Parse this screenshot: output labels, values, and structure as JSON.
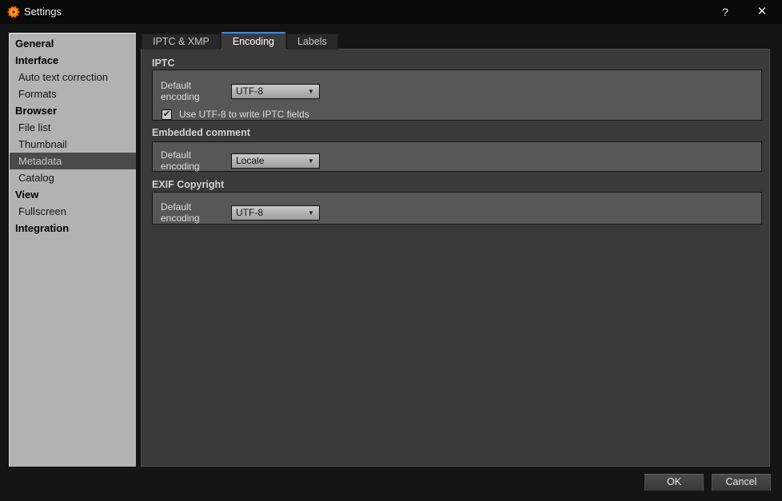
{
  "window": {
    "title": "Settings",
    "help_label": "?",
    "close_label": "✕"
  },
  "icons": {
    "dropdown_arrow": "▼",
    "checkbox_check": "✔"
  },
  "colors": {
    "accent_blue": "#2e8fff",
    "titlebar_bg": "#0a0a0a",
    "window_bg": "#141414",
    "sidebar_bg": "#b2b2b2",
    "sidebar_selected_bg": "#4a4a4a",
    "pane_bg": "#3a3a3a",
    "group_bg": "#575757",
    "app_icon_orange": "#ff8a00"
  },
  "sidebar": {
    "items": [
      {
        "label": "General"
      },
      {
        "label": "Interface"
      },
      {
        "label": "Auto text correction"
      },
      {
        "label": "Formats"
      },
      {
        "label": "Browser"
      },
      {
        "label": "File list"
      },
      {
        "label": "Thumbnail"
      },
      {
        "label": "Metadata",
        "selected": true
      },
      {
        "label": "Catalog"
      },
      {
        "label": "View"
      },
      {
        "label": "Fullscreen"
      },
      {
        "label": "Integration"
      }
    ]
  },
  "tabs": [
    {
      "label": "IPTC & XMP"
    },
    {
      "label": "Encoding",
      "active": true
    },
    {
      "label": "Labels"
    }
  ],
  "panel": {
    "groups": [
      {
        "title": "IPTC",
        "rows": [
          {
            "label": "Default encoding",
            "value": "UTF-8"
          },
          {
            "label": "Use UTF-8 to write IPTC fields",
            "checked": true
          }
        ]
      },
      {
        "title": "Embedded comment",
        "rows": [
          {
            "label": "Default encoding",
            "value": "Locale"
          }
        ]
      },
      {
        "title": "EXIF Copyright",
        "rows": [
          {
            "label": "Default encoding",
            "value": "UTF-8"
          }
        ]
      }
    ]
  },
  "footer": {
    "ok_label": "OK",
    "cancel_label": "Cancel"
  }
}
